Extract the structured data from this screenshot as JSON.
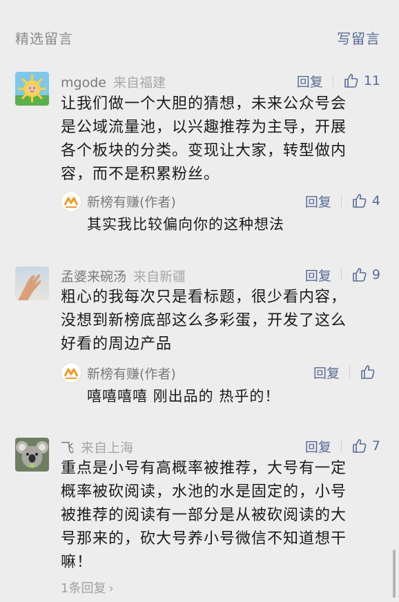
{
  "header": {
    "title": "精选留言",
    "write_label": "写留言"
  },
  "comments": [
    {
      "nickname": "mgode",
      "location": "来自福建",
      "reply_label": "回复",
      "likes": "11",
      "content_lines": [
        "让我们做一个大胆的猜想，未来公众号会",
        "是公域流量池，以兴趣推荐为主导，开展",
        "各个板块的分类。变现让大家，转型做内",
        "容，而不是积累粉丝。"
      ],
      "author_reply": {
        "name": "新榜有赚(作者)",
        "reply_label": "回复",
        "likes": "4",
        "text": "其实我比较偏向你的这种想法"
      }
    },
    {
      "nickname": "孟婆来碗汤",
      "location": "来自新疆",
      "reply_label": "回复",
      "likes": "9",
      "content_lines": [
        "粗心的我每次只是看标题，很少看内容，",
        "没想到新榜底部这么多彩蛋，开发了这么",
        "好看的周边产品"
      ],
      "author_reply": {
        "name": "新榜有赚(作者)",
        "reply_label": "回复",
        "likes": "",
        "text": "嘻嘻嘻嘻 刚出品的 热乎的！"
      }
    },
    {
      "nickname": "飞",
      "location": "来自上海",
      "reply_label": "回复",
      "likes": "7",
      "content_lines": [
        "重点是小号有高概率被推荐，大号有一定",
        "概率被砍阅读，水池的水是固定的，小号",
        "被推荐的阅读有一部分是从被砍阅读的大",
        "号那来的，砍大号养小号微信不知道想干",
        "嘛！"
      ],
      "more_replies": "1条回复"
    }
  ],
  "colors": {
    "background": "#ededed",
    "link": "#576b95",
    "text": "#1a1a1a",
    "muted": "#7a7a7a",
    "brand_orange": "#f39a1e"
  }
}
